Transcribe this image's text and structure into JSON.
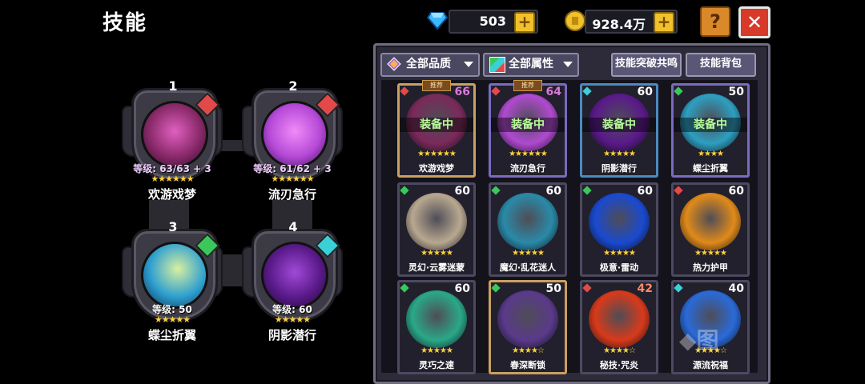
{
  "header": {
    "title": "技能",
    "diamonds": "503",
    "gold": "928.4万",
    "help_label": "?",
    "close_label": "✕"
  },
  "equipped": [
    {
      "num": "1",
      "level": "等级: 63/63 + 3",
      "stars": "★★★★★★",
      "name": "欢游戏梦",
      "elem_color": "#e24a4a",
      "orb": "#8a2a6a"
    },
    {
      "num": "2",
      "level": "等级: 61/62 + 3",
      "stars": "★★★★★★",
      "name": "流刃急行",
      "elem_color": "#e24a4a",
      "orb": "#b64ad8"
    },
    {
      "num": "3",
      "level": "等级: 50",
      "stars": "★★★★★",
      "name": "蝶尘折翼",
      "elem_color": "#3ac85a",
      "orb": "#2e9fd0"
    },
    {
      "num": "4",
      "level": "等级: 60",
      "stars": "★★★★★",
      "name": "阴影潜行",
      "elem_color": "#3ad0d8",
      "orb": "#5a1a8a"
    }
  ],
  "filters": {
    "quality": "全部品质",
    "attribute": "全部属性",
    "resonance": "技能突破共鸣",
    "backpack": "技能背包"
  },
  "cards": [
    {
      "name": "欢游戏梦",
      "level": "66",
      "stars": "★★★★★★",
      "equipped": "装备中",
      "rec": "推荐",
      "gem": "#e24a4a",
      "border": "#c9a060",
      "art": "#7a2a5a",
      "lvcolor": "#d87ad8"
    },
    {
      "name": "流刃急行",
      "level": "64",
      "stars": "★★★★★★",
      "equipped": "装备中",
      "rec": "推荐",
      "gem": "#e24a4a",
      "border": "#7a6ac0",
      "art": "#b04ad0",
      "lvcolor": "#d87ad8"
    },
    {
      "name": "阴影潜行",
      "level": "60",
      "stars": "★★★★★",
      "equipped": "装备中",
      "rec": "",
      "gem": "#3ad0d8",
      "border": "#4a8ac0",
      "art": "#5a1a8a",
      "lvcolor": "#ffffff"
    },
    {
      "name": "蝶尘折翼",
      "level": "50",
      "stars": "★★★★",
      "equipped": "装备中",
      "rec": "",
      "gem": "#3ac85a",
      "border": "#7a6ac0",
      "art": "#2e9fc0",
      "lvcolor": "#ffffff"
    },
    {
      "name": "灵幻·云雾迷蒙",
      "level": "60",
      "stars": "★★★★★",
      "equipped": "",
      "rec": "",
      "gem": "#3ac85a",
      "border": "#4c4960",
      "art": "#b8a890",
      "lvcolor": "#ffffff"
    },
    {
      "name": "魔幻·乱花迷人",
      "level": "60",
      "stars": "★★★★★",
      "equipped": "",
      "rec": "",
      "gem": "#3ac85a",
      "border": "#4c4960",
      "art": "#2a8aa8",
      "lvcolor": "#ffffff"
    },
    {
      "name": "极意·雷动",
      "level": "60",
      "stars": "★★★★★",
      "equipped": "",
      "rec": "",
      "gem": "#3ac85a",
      "border": "#4c4960",
      "art": "#1a4ad0",
      "lvcolor": "#ffffff"
    },
    {
      "name": "热力护甲",
      "level": "60",
      "stars": "★★★★★",
      "equipped": "",
      "rec": "",
      "gem": "#e24a4a",
      "border": "#4c4960",
      "art": "#e08a1a",
      "lvcolor": "#ffffff"
    },
    {
      "name": "灵巧之速",
      "level": "60",
      "stars": "★★★★★",
      "equipped": "",
      "rec": "",
      "gem": "#3ac85a",
      "border": "#4c4960",
      "art": "#2aa888",
      "lvcolor": "#ffffff"
    },
    {
      "name": "春深断锁",
      "level": "50",
      "stars": "★★★★☆",
      "equipped": "",
      "rec": "",
      "gem": "#3ac85a",
      "border": "#c9a060",
      "art": "#5a3a8a",
      "lvcolor": "#ffffff"
    },
    {
      "name": "秘技·咒炎",
      "level": "42",
      "stars": "★★★★☆",
      "equipped": "",
      "rec": "",
      "gem": "#e24a4a",
      "border": "#4c4960",
      "art": "#d83a1a",
      "lvcolor": "#ff8a6a"
    },
    {
      "name": "源流祝福",
      "level": "40",
      "stars": "★★★★☆",
      "equipped": "",
      "rec": "",
      "gem": "#3ad0d8",
      "border": "#4c4960",
      "art": "#2a6ad8",
      "lvcolor": "#ffffff"
    }
  ]
}
